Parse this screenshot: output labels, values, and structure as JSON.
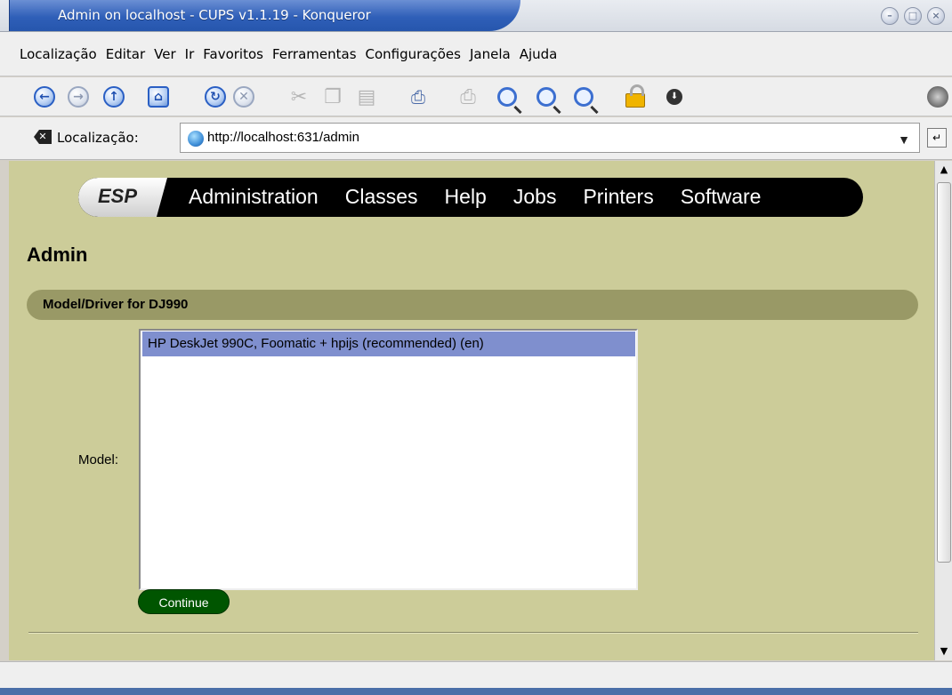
{
  "window": {
    "title": "Admin on localhost - CUPS v1.1.19 - Konqueror",
    "buttons": [
      "–",
      "□",
      "×"
    ]
  },
  "menu": {
    "items": [
      "Localização",
      "Editar",
      "Ver",
      "Ir",
      "Favoritos",
      "Ferramentas",
      "Configurações",
      "Janela",
      "Ajuda"
    ]
  },
  "toolbar": {
    "icons": [
      "back-icon",
      "forward-icon",
      "up-icon",
      "home-icon",
      "reload-icon",
      "stop-icon",
      "cut-icon",
      "copy-icon",
      "paste-icon",
      "print-icon",
      "print-frame-icon",
      "zoom-icon",
      "zoom-in-icon",
      "zoom-out-icon",
      "lock-icon",
      "download-icon",
      "throbber-icon"
    ]
  },
  "location": {
    "label": "Localização:",
    "url": "http://localhost:631/admin"
  },
  "page": {
    "nav": {
      "brand": "ESP",
      "links": [
        "Administration",
        "Classes",
        "Help",
        "Jobs",
        "Printers",
        "Software"
      ]
    },
    "title": "Admin",
    "section": "Model/Driver for DJ990",
    "model_label": "Model:",
    "options": [
      "HP DeskJet 990C, Foomatic + hpijs (recommended) (en)"
    ],
    "continue": "Continue"
  },
  "colors": {
    "page_bg": "#cccc99",
    "section_bar": "#999966",
    "selection": "#7f8fce",
    "continue_button": "#005500",
    "title_bar": "#2f5fb8"
  }
}
